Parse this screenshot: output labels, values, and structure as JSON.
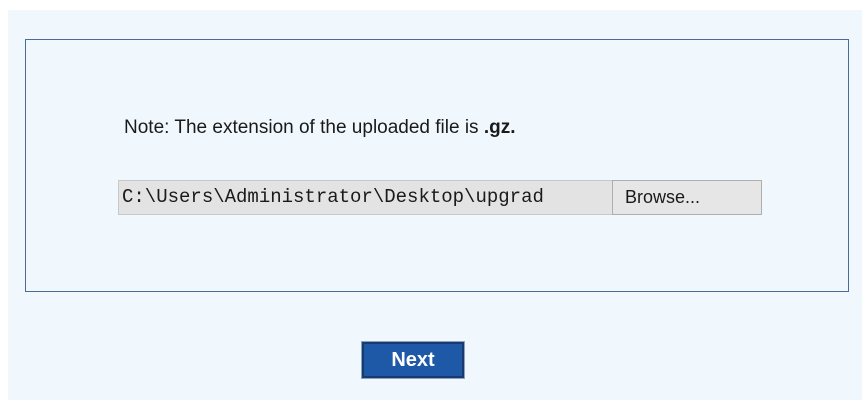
{
  "upload": {
    "note_label": "Note:",
    "note_text": " The extension of the uploaded file is ",
    "extension": ".gz.",
    "file_path_value": "C:\\Users\\Administrator\\Desktop\\upgrad",
    "browse_label": "Browse..."
  },
  "actions": {
    "next_label": "Next"
  },
  "colors": {
    "page_background": "#f0f8fe",
    "panel_border": "#4a6d98",
    "next_button": "#1d59a6"
  }
}
